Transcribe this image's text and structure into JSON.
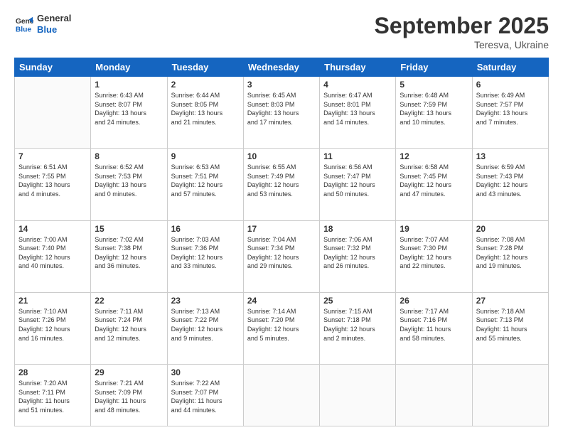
{
  "header": {
    "logo": {
      "line1": "General",
      "line2": "Blue"
    },
    "title": "September 2025",
    "location": "Teresva, Ukraine"
  },
  "weekdays": [
    "Sunday",
    "Monday",
    "Tuesday",
    "Wednesday",
    "Thursday",
    "Friday",
    "Saturday"
  ],
  "weeks": [
    [
      {
        "day": "",
        "info": ""
      },
      {
        "day": "1",
        "info": "Sunrise: 6:43 AM\nSunset: 8:07 PM\nDaylight: 13 hours\nand 24 minutes."
      },
      {
        "day": "2",
        "info": "Sunrise: 6:44 AM\nSunset: 8:05 PM\nDaylight: 13 hours\nand 21 minutes."
      },
      {
        "day": "3",
        "info": "Sunrise: 6:45 AM\nSunset: 8:03 PM\nDaylight: 13 hours\nand 17 minutes."
      },
      {
        "day": "4",
        "info": "Sunrise: 6:47 AM\nSunset: 8:01 PM\nDaylight: 13 hours\nand 14 minutes."
      },
      {
        "day": "5",
        "info": "Sunrise: 6:48 AM\nSunset: 7:59 PM\nDaylight: 13 hours\nand 10 minutes."
      },
      {
        "day": "6",
        "info": "Sunrise: 6:49 AM\nSunset: 7:57 PM\nDaylight: 13 hours\nand 7 minutes."
      }
    ],
    [
      {
        "day": "7",
        "info": "Sunrise: 6:51 AM\nSunset: 7:55 PM\nDaylight: 13 hours\nand 4 minutes."
      },
      {
        "day": "8",
        "info": "Sunrise: 6:52 AM\nSunset: 7:53 PM\nDaylight: 13 hours\nand 0 minutes."
      },
      {
        "day": "9",
        "info": "Sunrise: 6:53 AM\nSunset: 7:51 PM\nDaylight: 12 hours\nand 57 minutes."
      },
      {
        "day": "10",
        "info": "Sunrise: 6:55 AM\nSunset: 7:49 PM\nDaylight: 12 hours\nand 53 minutes."
      },
      {
        "day": "11",
        "info": "Sunrise: 6:56 AM\nSunset: 7:47 PM\nDaylight: 12 hours\nand 50 minutes."
      },
      {
        "day": "12",
        "info": "Sunrise: 6:58 AM\nSunset: 7:45 PM\nDaylight: 12 hours\nand 47 minutes."
      },
      {
        "day": "13",
        "info": "Sunrise: 6:59 AM\nSunset: 7:43 PM\nDaylight: 12 hours\nand 43 minutes."
      }
    ],
    [
      {
        "day": "14",
        "info": "Sunrise: 7:00 AM\nSunset: 7:40 PM\nDaylight: 12 hours\nand 40 minutes."
      },
      {
        "day": "15",
        "info": "Sunrise: 7:02 AM\nSunset: 7:38 PM\nDaylight: 12 hours\nand 36 minutes."
      },
      {
        "day": "16",
        "info": "Sunrise: 7:03 AM\nSunset: 7:36 PM\nDaylight: 12 hours\nand 33 minutes."
      },
      {
        "day": "17",
        "info": "Sunrise: 7:04 AM\nSunset: 7:34 PM\nDaylight: 12 hours\nand 29 minutes."
      },
      {
        "day": "18",
        "info": "Sunrise: 7:06 AM\nSunset: 7:32 PM\nDaylight: 12 hours\nand 26 minutes."
      },
      {
        "day": "19",
        "info": "Sunrise: 7:07 AM\nSunset: 7:30 PM\nDaylight: 12 hours\nand 22 minutes."
      },
      {
        "day": "20",
        "info": "Sunrise: 7:08 AM\nSunset: 7:28 PM\nDaylight: 12 hours\nand 19 minutes."
      }
    ],
    [
      {
        "day": "21",
        "info": "Sunrise: 7:10 AM\nSunset: 7:26 PM\nDaylight: 12 hours\nand 16 minutes."
      },
      {
        "day": "22",
        "info": "Sunrise: 7:11 AM\nSunset: 7:24 PM\nDaylight: 12 hours\nand 12 minutes."
      },
      {
        "day": "23",
        "info": "Sunrise: 7:13 AM\nSunset: 7:22 PM\nDaylight: 12 hours\nand 9 minutes."
      },
      {
        "day": "24",
        "info": "Sunrise: 7:14 AM\nSunset: 7:20 PM\nDaylight: 12 hours\nand 5 minutes."
      },
      {
        "day": "25",
        "info": "Sunrise: 7:15 AM\nSunset: 7:18 PM\nDaylight: 12 hours\nand 2 minutes."
      },
      {
        "day": "26",
        "info": "Sunrise: 7:17 AM\nSunset: 7:16 PM\nDaylight: 11 hours\nand 58 minutes."
      },
      {
        "day": "27",
        "info": "Sunrise: 7:18 AM\nSunset: 7:13 PM\nDaylight: 11 hours\nand 55 minutes."
      }
    ],
    [
      {
        "day": "28",
        "info": "Sunrise: 7:20 AM\nSunset: 7:11 PM\nDaylight: 11 hours\nand 51 minutes."
      },
      {
        "day": "29",
        "info": "Sunrise: 7:21 AM\nSunset: 7:09 PM\nDaylight: 11 hours\nand 48 minutes."
      },
      {
        "day": "30",
        "info": "Sunrise: 7:22 AM\nSunset: 7:07 PM\nDaylight: 11 hours\nand 44 minutes."
      },
      {
        "day": "",
        "info": ""
      },
      {
        "day": "",
        "info": ""
      },
      {
        "day": "",
        "info": ""
      },
      {
        "day": "",
        "info": ""
      }
    ]
  ]
}
